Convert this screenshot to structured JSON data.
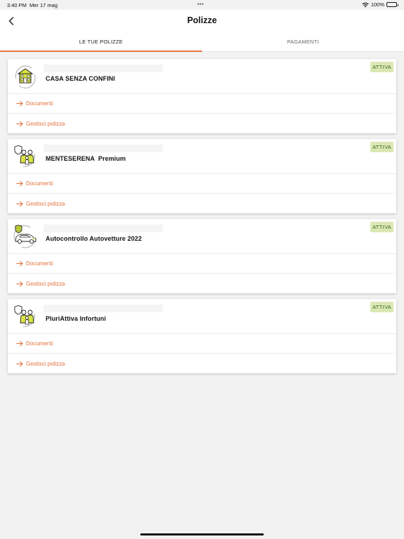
{
  "status": {
    "time": "3:40 PM",
    "date": "Mer 17 mag",
    "dots": "•••",
    "battery": "100%"
  },
  "nav": {
    "title": "Polizze"
  },
  "tabs": [
    {
      "label": "LE TUE POLIZZE"
    },
    {
      "label": "PAGAMENTI"
    }
  ],
  "colors": {
    "accent": "#e8743b",
    "badge_bg": "#dbe8b5",
    "badge_text": "#3c6b1a",
    "icon_yellow": "#d9e246"
  },
  "policies": [
    {
      "name": "CASA SENZA CONFINI",
      "badge": "ATTIVA",
      "icon": "house-icon",
      "link1": "Documenti",
      "link2": "Gestisci polizza"
    },
    {
      "name": "MENTESERENA  Premium",
      "badge": "ATTIVA",
      "icon": "family-shield-icon",
      "link1": "Documenti",
      "link2": "Gestisci polizza"
    },
    {
      "name": "Autocontrollo Autovetture 2022",
      "badge": "ATTIVA",
      "icon": "car-shield-icon",
      "link1": "Documenti",
      "link2": "Gestisci polizza"
    },
    {
      "name": "PluriAttiva Infortuni",
      "badge": "ATTIVA",
      "icon": "family-shield-icon",
      "link1": "Documenti",
      "link2": "Gestisci polizza"
    }
  ]
}
